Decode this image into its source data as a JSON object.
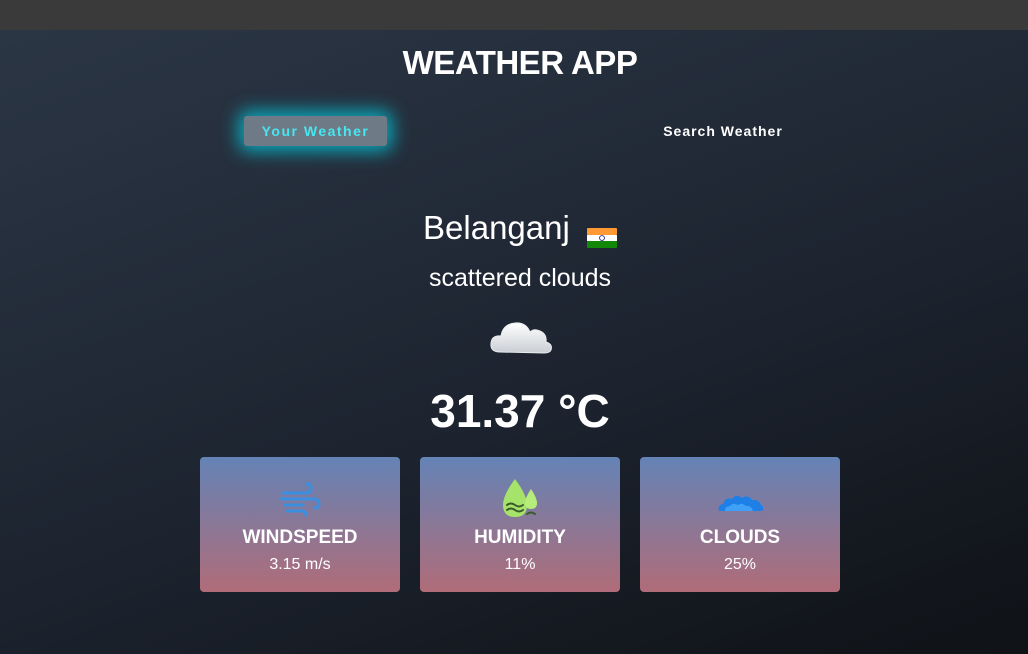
{
  "app": {
    "title": "WEATHER APP"
  },
  "tabs": [
    {
      "label": "Your Weather",
      "active": true
    },
    {
      "label": "Search Weather",
      "active": false
    }
  ],
  "weather": {
    "city": "Belanganj",
    "country_flag": "india-flag-icon",
    "description": "scattered clouds",
    "condition_icon": "cloud-icon",
    "temperature": "31.37 °C"
  },
  "stats": [
    {
      "label": "WINDSPEED",
      "value": "3.15 m/s",
      "icon": "wind-icon"
    },
    {
      "label": "HUMIDITY",
      "value": "11%",
      "icon": "humidity-icon"
    },
    {
      "label": "CLOUDS",
      "value": "25%",
      "icon": "clouds-icon"
    }
  ],
  "colors": {
    "accent": "#47e6f0",
    "glow": "#00d7eb",
    "card_top": "#6483b6",
    "card_bottom": "#b06c78"
  }
}
